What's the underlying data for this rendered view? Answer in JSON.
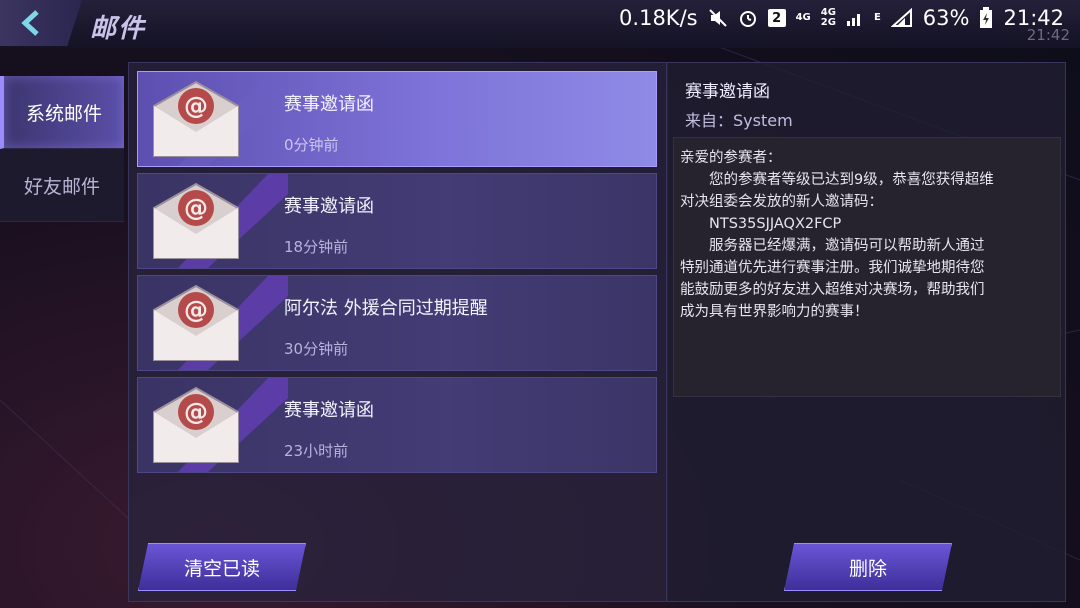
{
  "header": {
    "title": "邮件"
  },
  "status_bar": {
    "net_speed": "0.18K/s",
    "notif_count": "2",
    "sig1_top": "4G",
    "sig1_bottom": "",
    "sig2_top": "4G",
    "sig2_bottom": "2G",
    "e_label": "E",
    "battery": "63%",
    "time": "21:42",
    "ghost_time": "21:42"
  },
  "tabs": [
    {
      "label": "系统邮件",
      "active": true
    },
    {
      "label": "好友邮件",
      "active": false
    }
  ],
  "mails": [
    {
      "title": "赛事邀请函",
      "time": "0分钟前",
      "selected": true
    },
    {
      "title": "赛事邀请函",
      "time": "18分钟前",
      "selected": false
    },
    {
      "title": "阿尔法 外援合同过期提醒",
      "time": "30分钟前",
      "selected": false
    },
    {
      "title": "赛事邀请函",
      "time": "23小时前",
      "selected": false
    }
  ],
  "actions": {
    "clear_read": "清空已读",
    "delete": "删除"
  },
  "detail": {
    "title": "赛事邀请函",
    "from": "来自：System",
    "body_lines": [
      "亲爱的参赛者：",
      "　　您的参赛者等级已达到9级，恭喜您获得超维",
      "对决组委会发放的新人邀请码：",
      "　　NTS35SJJAQX2FCP",
      "　　服务器已经爆满，邀请码可以帮助新人通过",
      "特别通道优先进行赛事注册。我们诚挚地期待您",
      "能鼓励更多的好友进入超维对决赛场，帮助我们",
      "成为具有世界影响力的赛事！"
    ]
  },
  "colors": {
    "accent": "#7d72d8",
    "button": "#5a46c4"
  }
}
